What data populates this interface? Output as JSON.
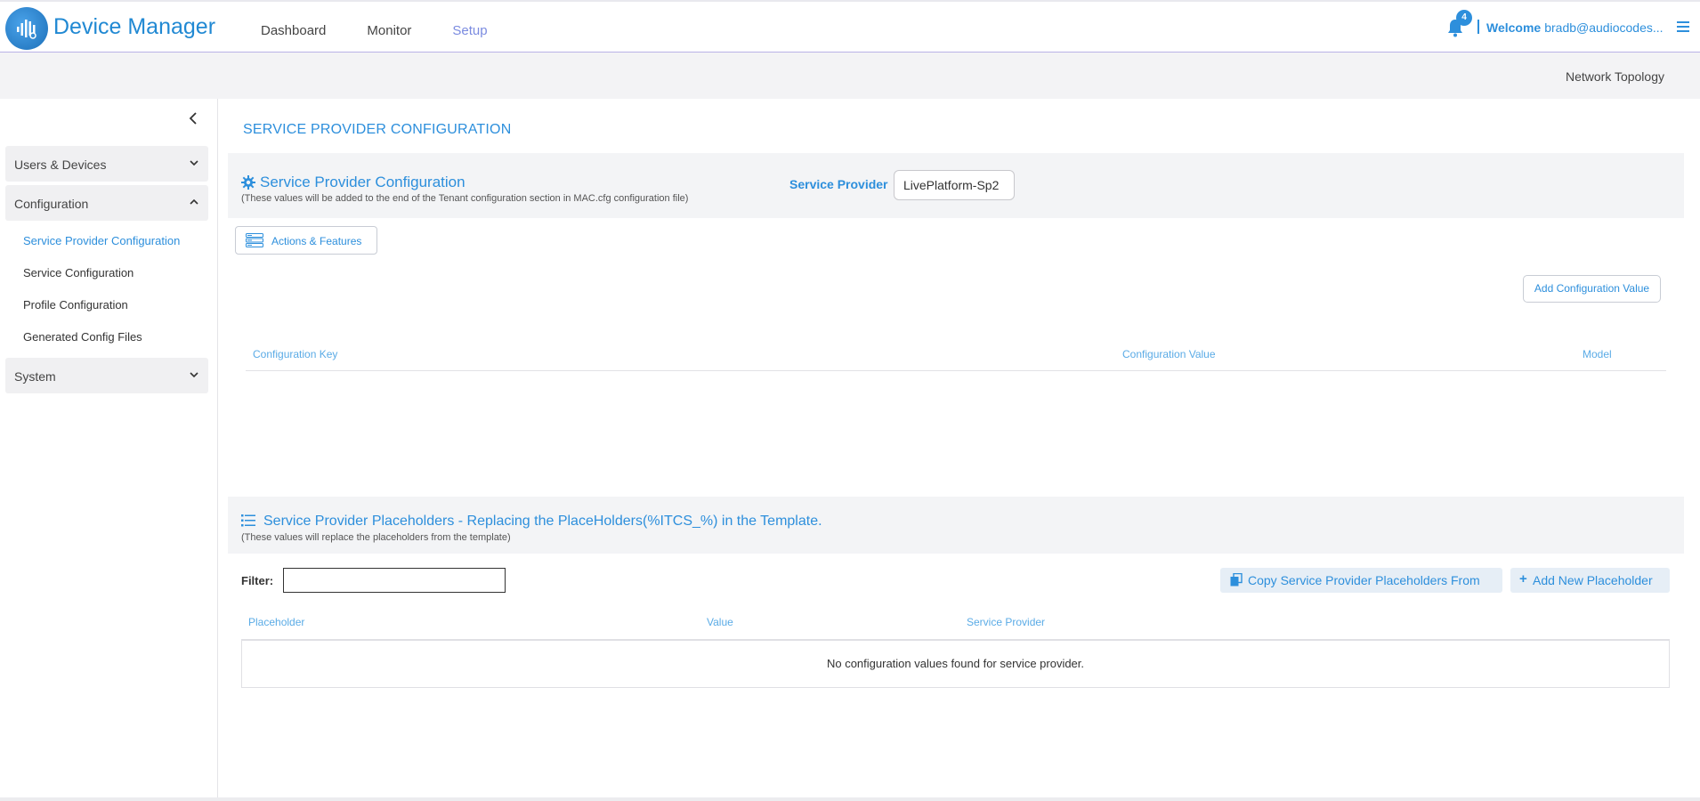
{
  "header": {
    "app_title": "Device Manager",
    "nav": [
      "Dashboard",
      "Monitor",
      "Setup"
    ],
    "active_nav": "Setup",
    "notifications_count": "4",
    "welcome_label": "Welcome",
    "user": "bradb@audiocodes..."
  },
  "subheader": {
    "network_topology": "Network Topology"
  },
  "sidebar": {
    "groups": [
      {
        "label": "Users & Devices",
        "expanded": false
      },
      {
        "label": "Configuration",
        "expanded": true
      },
      {
        "label": "System",
        "expanded": false
      }
    ],
    "config_items": [
      {
        "label": "Service Provider Configuration",
        "active": true
      },
      {
        "label": "Service Configuration",
        "active": false
      },
      {
        "label": "Profile Configuration",
        "active": false
      },
      {
        "label": "Generated Config Files",
        "active": false
      }
    ]
  },
  "main": {
    "page_title": "SERVICE PROVIDER CONFIGURATION",
    "config_panel": {
      "title": "Service Provider Configuration",
      "subtitle": "(These values will be added to the end of the Tenant configuration section in MAC.cfg configuration file)",
      "service_provider_label": "Service Provider",
      "service_provider_value": "LivePlatform-Sp2"
    },
    "actions_button": "Actions & Features",
    "add_config_button": "Add Configuration Value",
    "config_table": {
      "columns": [
        "Configuration Key",
        "Configuration Value",
        "Model"
      ]
    },
    "placeholders_panel": {
      "title": "Service Provider Placeholders - Replacing the PlaceHolders(%ITCS_%) in the Template.",
      "subtitle": "(These values will replace the placeholders from the template)"
    },
    "filter": {
      "label": "Filter:",
      "value": ""
    },
    "copy_button": "Copy Service Provider Placeholders From",
    "add_placeholder_button": "Add New Placeholder",
    "placeholder_table": {
      "columns": [
        "Placeholder",
        "Value",
        "Service Provider"
      ],
      "empty_message": "No configuration values found for service provider."
    }
  },
  "colors": {
    "accent": "#2d8fdc",
    "nav_active": "#7b8be0",
    "panel_bg": "#f3f4f6"
  }
}
